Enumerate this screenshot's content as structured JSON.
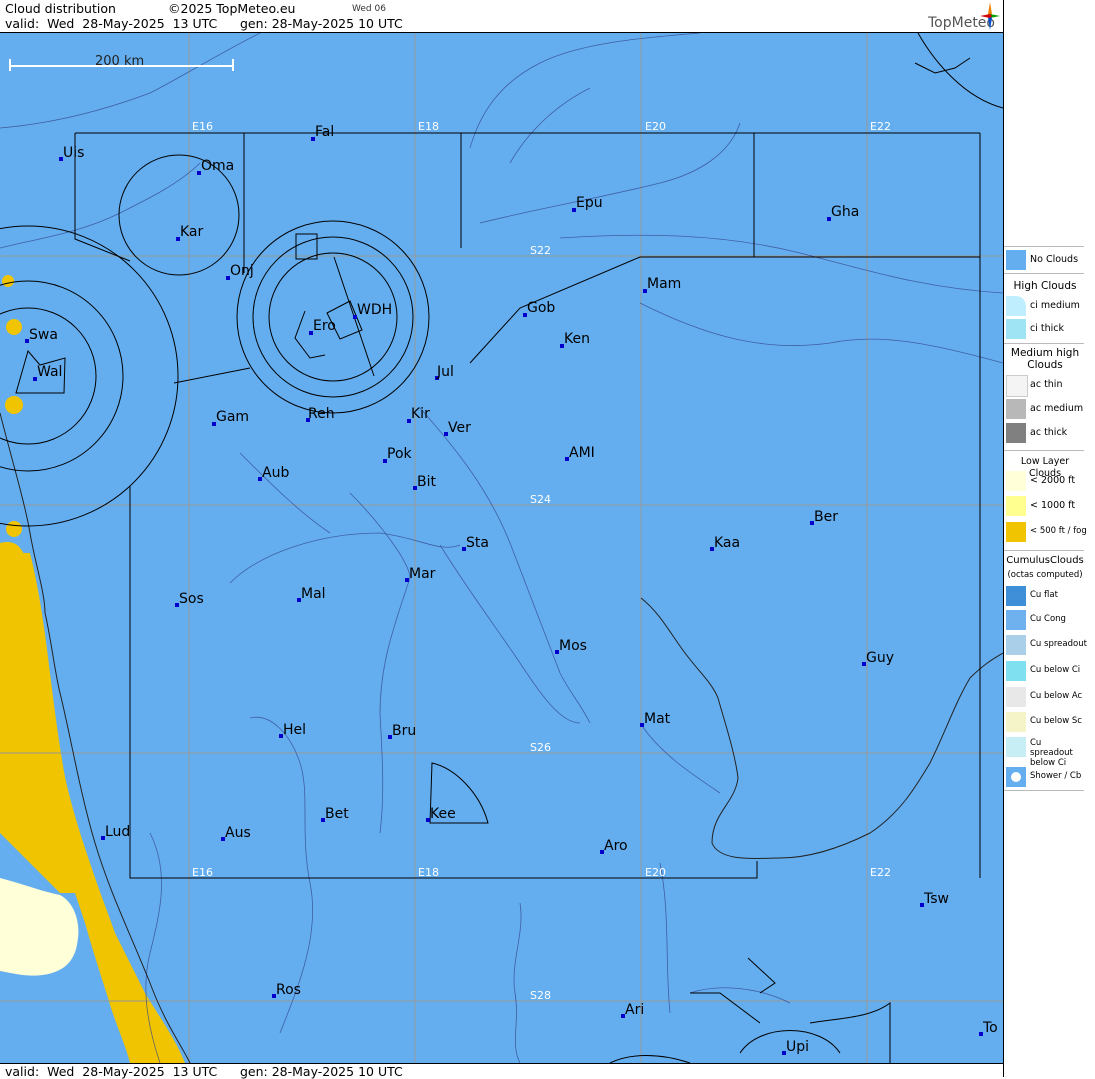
{
  "header": {
    "title": "Cloud distribution",
    "copyright": "©2025 TopMeteo.eu",
    "small_tag": "Wed 06",
    "valid": "valid:  Wed  28-May-2025  13 UTC",
    "gen": "gen: 28-May-2025 10 UTC",
    "brand": "TopMeteo"
  },
  "footer": {
    "valid": "valid:  Wed  28-May-2025  13 UTC",
    "gen": "gen: 28-May-2025 10 UTC"
  },
  "map": {
    "scale_label": "200 km",
    "colors": {
      "sea": "#64aef0",
      "fog": "#f0c400",
      "low": "#ffffd8",
      "grid": "#999999",
      "station": "#0000cc"
    },
    "grid_labels": {
      "lon_top": [
        "E16",
        "E18",
        "E20",
        "E22"
      ],
      "lon_bottom": [
        "E16",
        "E18",
        "E20",
        "E22"
      ],
      "lat": [
        "S22",
        "S24",
        "S26",
        "S28"
      ]
    },
    "stations": [
      "Uis",
      "Fal",
      "Oma",
      "Kar",
      "Epu",
      "Gha",
      "Onj",
      "Mam",
      "Gob",
      "WDH",
      "Ero",
      "Swa",
      "Ken",
      "Wal",
      "Jul",
      "Gam",
      "Reh",
      "Kir",
      "Ver",
      "AMI",
      "Pok",
      "Aub",
      "Bit",
      "Ber",
      "Sta",
      "Kaa",
      "Mar",
      "Sos",
      "Mal",
      "Mos",
      "Guy",
      "Mat",
      "Hel",
      "Bru",
      "Bet",
      "Kee",
      "Lud",
      "Aus",
      "Aro",
      "Tsw",
      "Ros",
      "Ari",
      "To",
      "Upi"
    ]
  },
  "legend": {
    "no_clouds": "No Clouds",
    "high_title": "High Clouds",
    "high_items": [
      "ci medium",
      "ci thick"
    ],
    "medium_title": "Medium high Clouds",
    "medium_items": [
      "ac thin",
      "ac medium",
      "ac thick"
    ],
    "low_title": "Low Layer Clouds",
    "low_items": [
      "< 2000 ft",
      "< 1000 ft",
      "< 500 ft / fog"
    ],
    "cu_title": "CumulusClouds",
    "cu_subtitle": "(octas computed)",
    "cu_items": [
      "Cu flat",
      "Cu Cong",
      "Cu spreadout",
      "Cu below Ci",
      "Cu below Ac",
      "Cu below Sc",
      "Cu spreadout below Ci",
      "Shower / Cb"
    ]
  }
}
